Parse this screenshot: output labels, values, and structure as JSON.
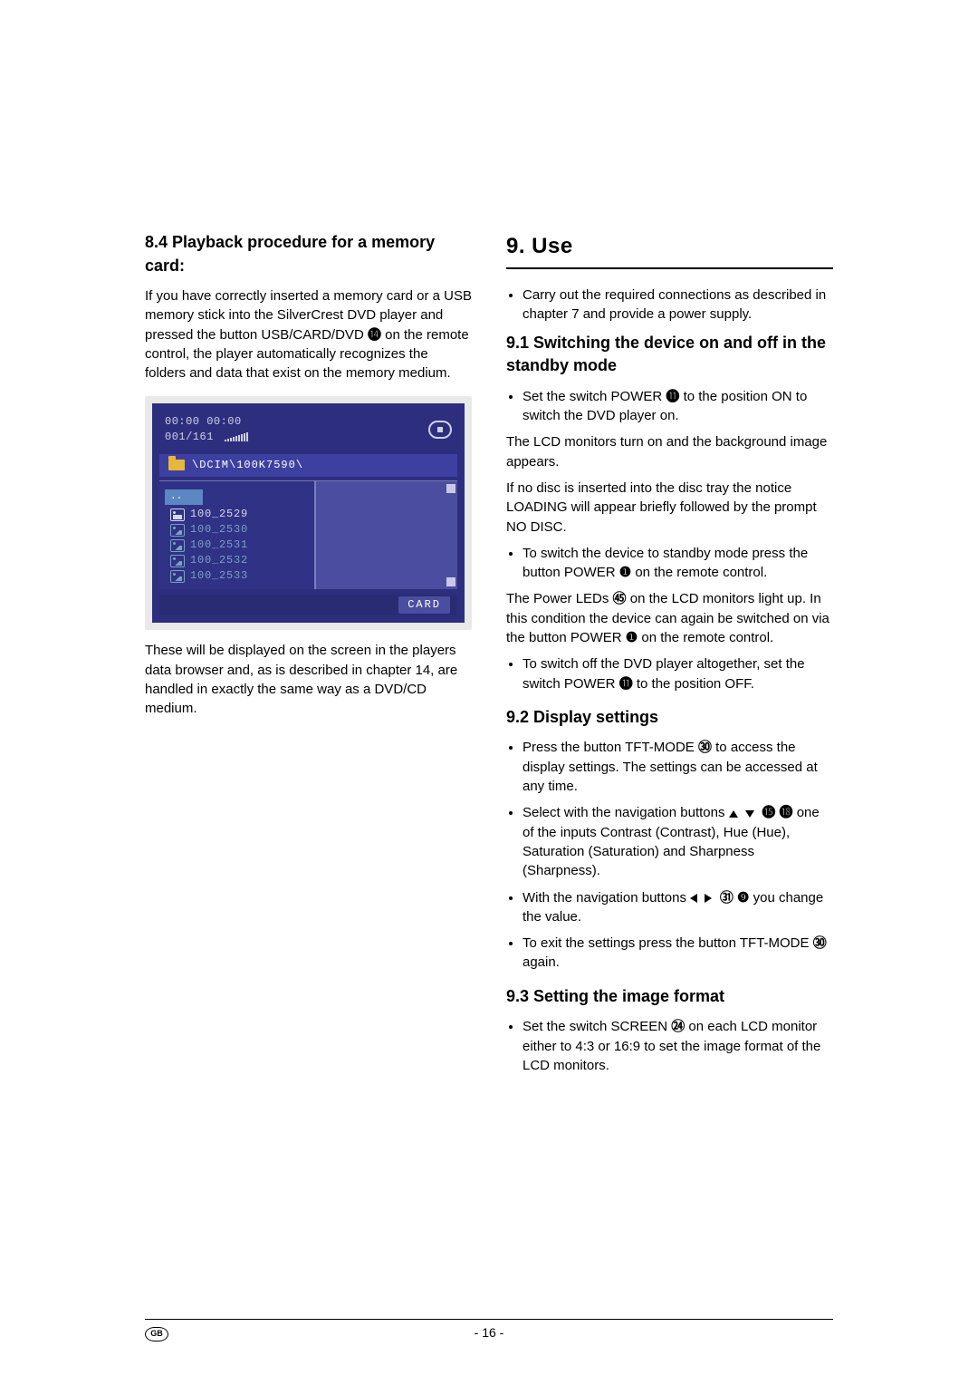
{
  "left": {
    "h84": "8.4 Playback procedure for a memory card:",
    "p1a": "If you have correctly inserted a memory card or a USB memory stick into the SilverCrest DVD player and pressed the button USB/CARD/DVD ",
    "p1_ref": "⓮",
    "p1b": " on the remote control, the player automatically recognizes the folders and data that exist on the memory medium.",
    "shot": {
      "time": "00:00  00:00",
      "index": "001/161",
      "path": "\\DCIM\\100K7590\\",
      "hdr": "..",
      "files": [
        "100_2529",
        "100_2530",
        "100_2531",
        "100_2532",
        "100_2533"
      ],
      "card": "CARD"
    },
    "p2": "These will be displayed on the screen in the players data browser and, as is described in chapter 14, are handled in exactly the same way as a DVD/CD medium."
  },
  "right": {
    "chapter": "9. Use",
    "b1": "Carry out the required connections as described in chapter 7 and provide a power supply.",
    "h91": "9.1 Switching the device on and off in the standby mode",
    "b91a_a": "Set the switch POWER ",
    "b91a_ref": "⓫",
    "b91a_b": " to the position ON to switch the DVD player on.",
    "p91a": "The LCD monitors turn on and the background image appears.",
    "p91b": "If no disc is inserted into the disc tray the notice LOADING will appear briefly followed by the prompt NO DISC.",
    "b91b_a": "To switch the device to standby mode press the button POWER ",
    "b91b_ref": "❶",
    "b91b_b": " on the remote control.",
    "p91c_a": "The Power LEDs ",
    "p91c_ref": "㊺",
    "p91c_b": " on the LCD monitors light up. In this condition the device can again be switched on via the button POWER ",
    "p91c_ref2": "❶",
    "p91c_c": " on the remote control.",
    "b91c_a": "To switch off the DVD player altogether, set the switch POWER ",
    "b91c_ref": "⓫",
    "b91c_b": " to the position OFF.",
    "h92": "9.2 Display settings",
    "b92a_a": "Press the button TFT-MODE ",
    "b92a_ref": "㉚",
    "b92a_b": " to access the display settings. The settings can be accessed at any time.",
    "b92b_a": "Select with the navigation buttons ",
    "b92b_ref1": "⓯",
    "b92b_ref2": "⓲",
    "b92b_b": " one of the inputs Contrast (Contrast), Hue (Hue), Saturation (Saturation) and Sharpness (Sharpness).",
    "b92c_a": "With the navigation buttons ",
    "b92c_ref1": "㉛",
    "b92c_ref2": "❾",
    "b92c_b": " you change the value.",
    "b92d_a": "To exit the settings press the button TFT-MODE ",
    "b92d_ref": "㉚",
    "b92d_b": " again.",
    "h93": "9.3 Setting the image format",
    "b93_a": "Set the switch SCREEN ",
    "b93_ref": "㉔",
    "b93_b": " on each LCD monitor either to 4:3 or 16:9 to set the image format of the LCD monitors."
  },
  "footer": {
    "gb": "GB",
    "page": "- 16 -"
  }
}
